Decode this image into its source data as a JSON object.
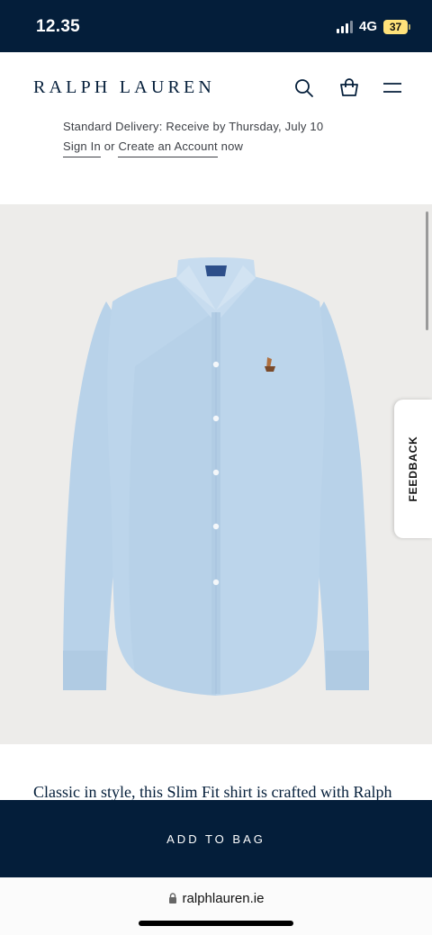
{
  "status_bar": {
    "time": "12.35",
    "network": "4G",
    "battery": "37"
  },
  "header": {
    "brand": "RALPH LAUREN",
    "icons": [
      "search-icon",
      "shopping-bag-icon",
      "menu-icon"
    ]
  },
  "delivery": {
    "text": "Standard Delivery: Receive by Thursday, July 10",
    "sign_in": "Sign In",
    "or": "or",
    "create_account": "Create an Account",
    "now": "now"
  },
  "product": {
    "image": "light-blue-oxford-shirt"
  },
  "feedback": {
    "label": "FEEDBACK"
  },
  "description": {
    "text": "Classic in style, this Slim Fit shirt is crafted with Ralph"
  },
  "cta": {
    "add_to_bag": "ADD TO BAG"
  },
  "browser": {
    "url": "ralphlauren.ie"
  },
  "colors": {
    "navy": "#041e3a",
    "shirt": "#b9d3ea",
    "battery": "#ffe27a"
  }
}
